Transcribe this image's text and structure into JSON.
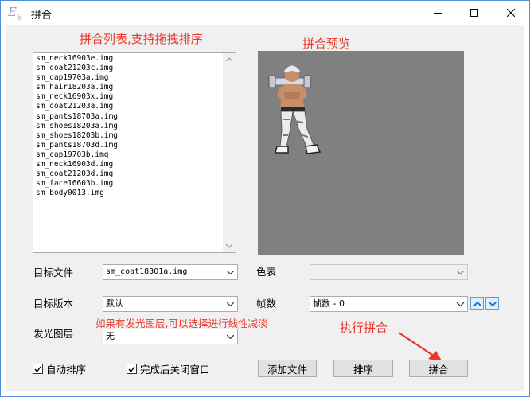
{
  "window": {
    "title": "拼合",
    "icon": "es-app-icon",
    "controls": [
      "minimize-icon",
      "maximize-icon",
      "close-icon"
    ]
  },
  "annotations": {
    "list_hint": "拼合列表,支持拖拽排序",
    "preview_hint": "拼合预览",
    "glow_hint": "如果有发光图层,可以选择进行线性减淡",
    "merge_hint": "执行拼合"
  },
  "file_list": {
    "items": [
      "sm_neck16903e.img",
      "sm_coat21203c.img",
      "sm_cap19703a.img",
      "sm_hair18203a.img",
      "sm_neck16903x.img",
      "sm_coat21203a.img",
      "sm_pants18703a.img",
      "sm_shoes18203a.img",
      "sm_shoes18203b.img",
      "sm_pants18703d.img",
      "sm_cap19703b.img",
      "sm_neck16903d.img",
      "sm_coat21203d.img",
      "sm_face16603b.img",
      "sm_body0013.img"
    ]
  },
  "form": {
    "target_file_label": "目标文件",
    "target_file_value": "sm_coat18301a.img",
    "target_version_label": "目标版本",
    "target_version_value": "默认",
    "glow_layer_label": "发光图层",
    "glow_layer_value": "无",
    "palette_label": "色表",
    "palette_value": "",
    "frame_label": "帧数",
    "frame_value": "帧数 - 0"
  },
  "checkboxes": {
    "auto_sort": {
      "label": "自动排序",
      "checked": true
    },
    "close_after": {
      "label": "完成后关闭窗口",
      "checked": true
    }
  },
  "buttons": {
    "add_file": "添加文件",
    "sort": "排序",
    "merge": "拼合"
  },
  "colors": {
    "annotation_red": "#e8372b",
    "preview_bg": "#808080",
    "window_border": "#4d90d9"
  }
}
